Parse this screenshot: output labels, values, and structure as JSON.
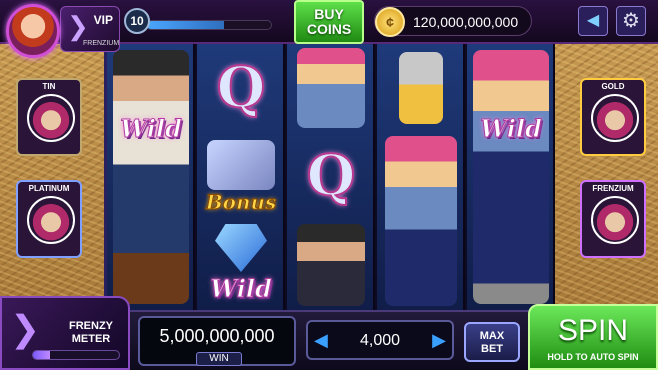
{
  "header": {
    "vip_label": "VIP",
    "vip_tier": "FRENZIUM",
    "level": "10",
    "level_progress": 0.62,
    "buy_coins_line1": "BUY",
    "buy_coins_line2": "COINS",
    "coin_balance": "120,000,000,000"
  },
  "tiers": {
    "tin": "TIN",
    "platinum": "PLATINUM",
    "gold": "GOLD",
    "frenzium": "FRENZIUM"
  },
  "reels": {
    "wild_text": "Wild",
    "bonus_text": "Bonus",
    "q_text": "Q"
  },
  "footer": {
    "frenzy_line1": "FRENZY",
    "frenzy_line2": "METER",
    "frenzy_progress": 0.2,
    "win_amount": "5,000,000,000",
    "win_label": "WIN",
    "bet_amount": "4,000",
    "max_bet_line1": "MAX",
    "max_bet_line2": "BET",
    "spin_label": "SPIN",
    "spin_sub": "HOLD TO AUTO SPIN"
  },
  "colors": {
    "accent_purple": "#d14fd6",
    "spin_green": "#3ec02a",
    "coin_gold": "#ffcc40"
  },
  "icons": [
    "avatar",
    "vip-wing-icon",
    "coin-icon",
    "back-arrow-icon",
    "gear-icon",
    "frenzy-wing-icon",
    "arrow-left-icon",
    "arrow-right-icon"
  ]
}
